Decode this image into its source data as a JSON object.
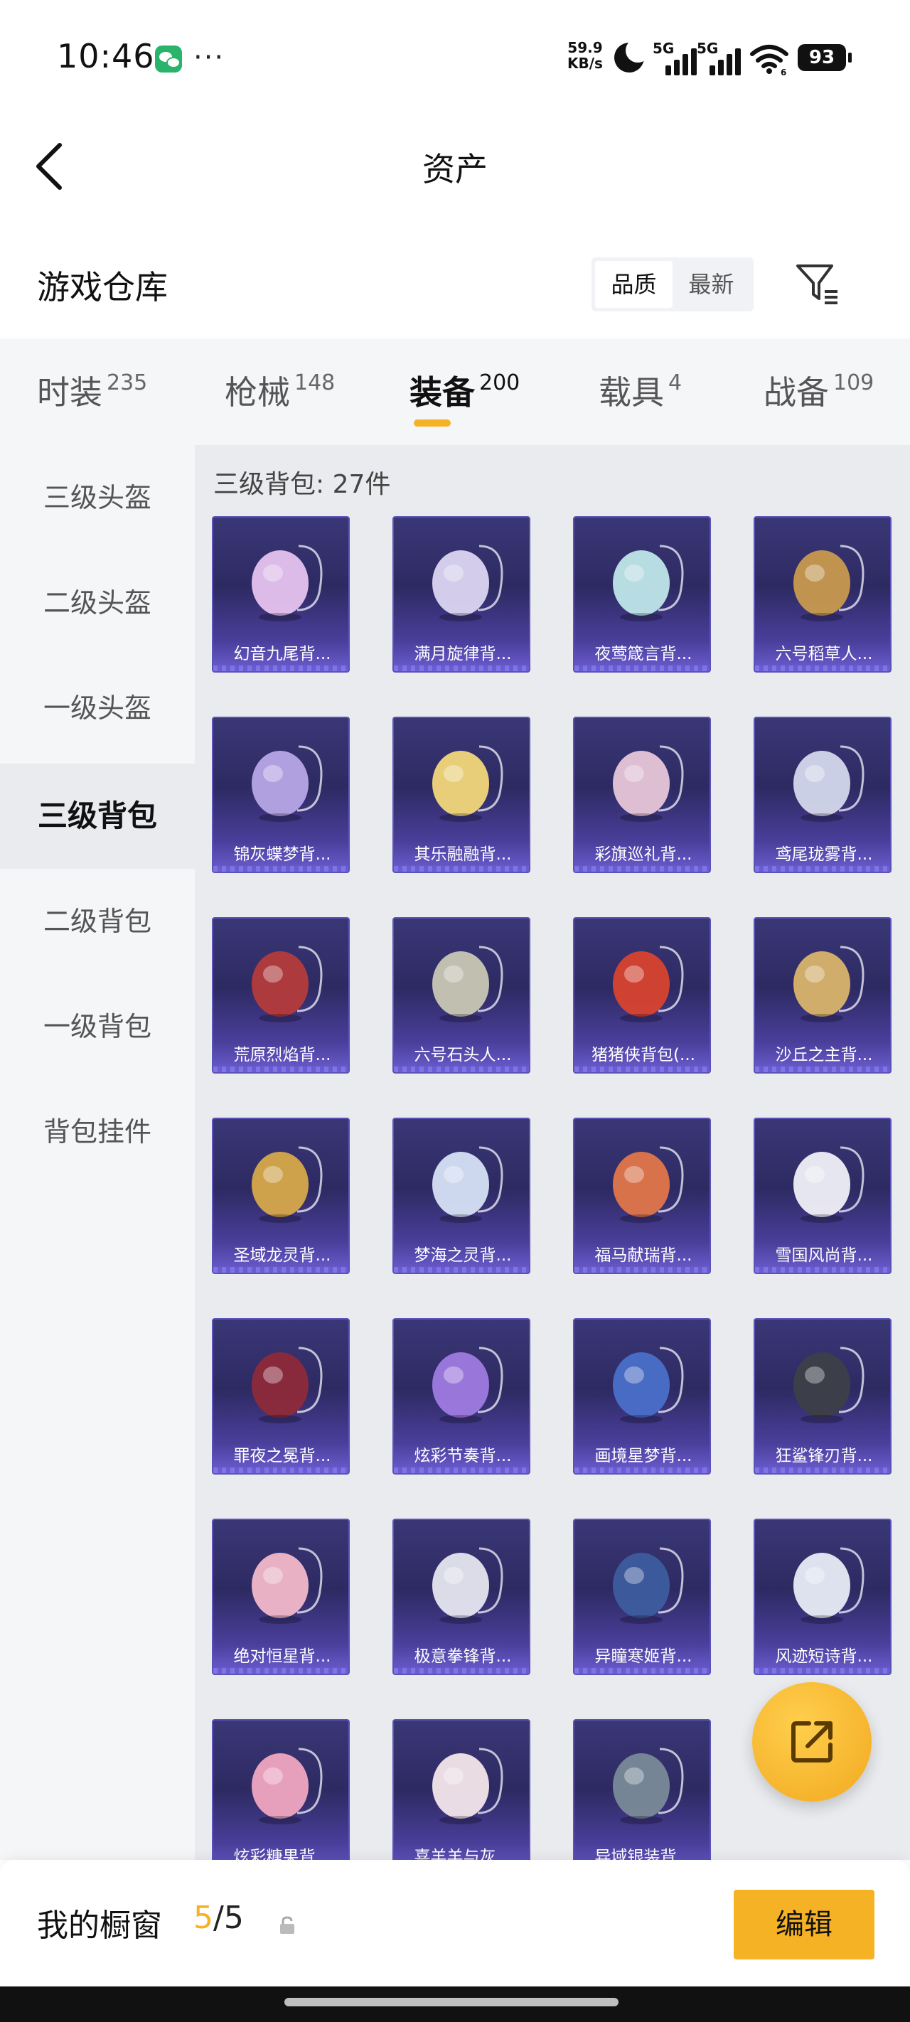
{
  "status_bar": {
    "time": "10:46",
    "net_speed_value": "59.9",
    "net_speed_unit": "KB/s",
    "signal_1": "5G",
    "signal_2": "5G",
    "wifi_badge": "6",
    "battery": "93"
  },
  "header": {
    "title": "资产"
  },
  "section": {
    "title": "游戏仓库",
    "sort_options": [
      {
        "label": "品质",
        "active": true
      },
      {
        "label": "最新",
        "active": false
      }
    ]
  },
  "tabs": [
    {
      "label": "时装",
      "count": "235"
    },
    {
      "label": "枪械",
      "count": "148"
    },
    {
      "label": "装备",
      "count": "200"
    },
    {
      "label": "载具",
      "count": "4"
    },
    {
      "label": "战备",
      "count": "109"
    }
  ],
  "active_tab": "装备",
  "sidenav": [
    {
      "label": "三级头盔"
    },
    {
      "label": "二级头盔"
    },
    {
      "label": "一级头盔"
    },
    {
      "label": "三级背包"
    },
    {
      "label": "二级背包"
    },
    {
      "label": "一级背包"
    },
    {
      "label": "背包挂件"
    }
  ],
  "active_side": "三级背包",
  "content": {
    "group_title": "三级背包: 27件",
    "items": [
      {
        "name": "幻音九尾背...",
        "icon": "fox-tail-backpack",
        "color": "#e7c3ef"
      },
      {
        "name": "满月旋律背...",
        "icon": "moon-melody-backpack",
        "color": "#dcd6f2"
      },
      {
        "name": "夜莺箴言背...",
        "icon": "nightingale-backpack",
        "color": "#bfe6e9"
      },
      {
        "name": "六号稻草人...",
        "icon": "scarecrow-backpack",
        "color": "#c89a4e"
      },
      {
        "name": "锦灰蝶梦背...",
        "icon": "butterfly-backpack",
        "color": "#b7a7e6"
      },
      {
        "name": "其乐融融背...",
        "icon": "cake-backpack",
        "color": "#f2d77a"
      },
      {
        "name": "彩旗巡礼背...",
        "icon": "flag-parade-backpack",
        "color": "#e7c6d8"
      },
      {
        "name": "鸢尾珑雾背...",
        "icon": "iris-mist-backpack",
        "color": "#d4d8ec"
      },
      {
        "name": "荒原烈焰背...",
        "icon": "flame-backpack",
        "color": "#b43b3b"
      },
      {
        "name": "六号石头人...",
        "icon": "stone-man-backpack",
        "color": "#c8c7b4"
      },
      {
        "name": "猪猪侠背包(...",
        "icon": "pig-hero-backpack",
        "color": "#d8432f"
      },
      {
        "name": "沙丘之主背...",
        "icon": "dune-backpack",
        "color": "#d9b46a"
      },
      {
        "name": "圣域龙灵背...",
        "icon": "dragon-backpack",
        "color": "#d7a84a"
      },
      {
        "name": "梦海之灵背...",
        "icon": "dream-sea-backpack",
        "color": "#d6e2f6"
      },
      {
        "name": "福马献瑞背...",
        "icon": "horse-backpack",
        "color": "#e0764a"
      },
      {
        "name": "雪国风尚背...",
        "icon": "penguin-backpack",
        "color": "#f0f0f8"
      },
      {
        "name": "罪夜之冕背...",
        "icon": "night-crown-backpack",
        "color": "#8e2a3a"
      },
      {
        "name": "炫彩节奏背...",
        "icon": "rhythm-backpack",
        "color": "#9f7be0"
      },
      {
        "name": "画境星梦背...",
        "icon": "star-dream-backpack",
        "color": "#4a6fc9"
      },
      {
        "name": "狂鲨锋刃背...",
        "icon": "shark-backpack",
        "color": "#3d3f48"
      },
      {
        "name": "绝对恒星背...",
        "icon": "popcorn-backpack",
        "color": "#f2b8c9"
      },
      {
        "name": "极意拳锋背...",
        "icon": "fist-backpack",
        "color": "#e6e6f0"
      },
      {
        "name": "异瞳寒姬背...",
        "icon": "cold-eye-backpack",
        "color": "#3d5d9e"
      },
      {
        "name": "风迹短诗背...",
        "icon": "wind-poem-backpack",
        "color": "#e8ecf6"
      },
      {
        "name": "炫彩糖果背...",
        "icon": "donut-backpack",
        "color": "#f0a6c0"
      },
      {
        "name": "喜羊羊与灰...",
        "icon": "sheep-backpack",
        "color": "#f3e6ea"
      },
      {
        "name": "异域银装背...",
        "icon": "silver-gear-backpack",
        "color": "#7a8a98"
      }
    ]
  },
  "bottom": {
    "window_label": "我的橱窗",
    "window_current": "5",
    "window_total": "/5",
    "edit_label": "编辑"
  },
  "colors": {
    "accent": "#f4b224",
    "card_bg": "#2d2a62"
  }
}
